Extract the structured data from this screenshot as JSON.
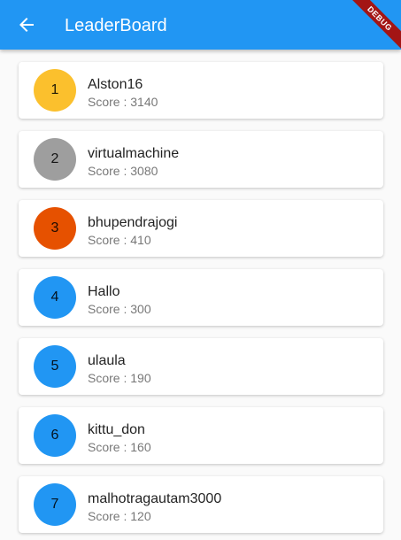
{
  "appbar": {
    "title": "LeaderBoard",
    "back_icon": "arrow-back-icon",
    "color": "#2196f3"
  },
  "debug_banner": {
    "label": "DEBUG",
    "color": "#a31515"
  },
  "leaderboard": [
    {
      "rank": "1",
      "name": "Alston16",
      "score": "Score : 3140",
      "avatar_color": "#fbc02d"
    },
    {
      "rank": "2",
      "name": "virtualmachine",
      "score": "Score : 3080",
      "avatar_color": "#9e9e9e"
    },
    {
      "rank": "3",
      "name": "bhupendrajogi",
      "score": "Score : 410",
      "avatar_color": "#e65100"
    },
    {
      "rank": "4",
      "name": "Hallo",
      "score": "Score : 300",
      "avatar_color": "#2196f3"
    },
    {
      "rank": "5",
      "name": "ulaula",
      "score": "Score : 190",
      "avatar_color": "#2196f3"
    },
    {
      "rank": "6",
      "name": "kittu_don",
      "score": "Score : 160",
      "avatar_color": "#2196f3"
    },
    {
      "rank": "7",
      "name": "malhotragautam3000",
      "score": "Score : 120",
      "avatar_color": "#2196f3"
    }
  ]
}
